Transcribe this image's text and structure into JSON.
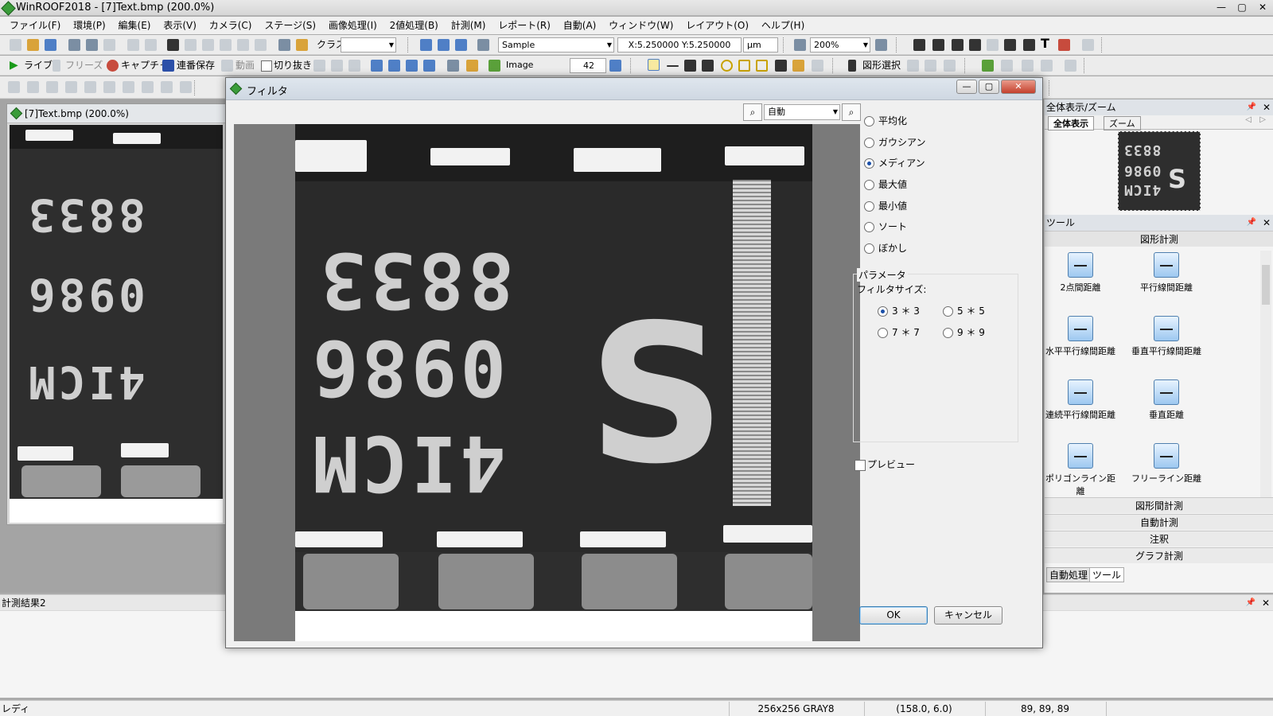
{
  "app": {
    "title": "WinROOF2018 - [7]Text.bmp (200.0%)"
  },
  "window_controls": {
    "minimize": "—",
    "restore": "▢",
    "close": "✕"
  },
  "menu": [
    "ファイル(F)",
    "環境(P)",
    "編集(E)",
    "表示(V)",
    "カメラ(C)",
    "ステージ(S)",
    "画像処理(I)",
    "2値処理(B)",
    "計測(M)",
    "レポート(R)",
    "自動(A)",
    "ウィンドウ(W)",
    "レイアウト(O)",
    "ヘルプ(H)"
  ],
  "toolbar1": {
    "class_label": "クラス",
    "class_value": "",
    "sample_value": "Sample",
    "coords": "X:5.250000  Y:5.250000",
    "unit": "μm",
    "zoom": "200%"
  },
  "toolbar2": {
    "live": "ライブ",
    "freeze": "フリーズ",
    "capture": "キャプチャ",
    "serial_save": "連番保存",
    "video": "動画",
    "crop": "切り抜き",
    "image_value": "Image",
    "spin_value": "42",
    "shape_select": "図形選択"
  },
  "child_window": {
    "title": "[7]Text.bmp (200.0%)"
  },
  "dialog": {
    "title": "フィルタ",
    "zoom_value": "自動",
    "filters": [
      "平均化",
      "ガウシアン",
      "メディアン",
      "最大値",
      "最小値",
      "ソート",
      "ぼかし"
    ],
    "selected_filter": "メディアン",
    "param_group": "パラメータ",
    "filter_size_label": "フィルタサイズ:",
    "sizes": [
      "3 ＊ 3",
      "5 ＊ 5",
      "7 ＊ 7",
      "9 ＊ 9"
    ],
    "selected_size": "3 ＊ 3",
    "preview_label": "プレビュー",
    "preview_checked": false,
    "ok": "OK",
    "cancel": "キャンセル"
  },
  "chip_marking": {
    "line1": "8833",
    "line2": "0986",
    "line3": "4ICM",
    "logo": "S"
  },
  "right_panel": {
    "overview": {
      "title": "全体表示/ズーム",
      "tab_all": "全体表示",
      "tab_zoom": "ズーム"
    },
    "tools": {
      "title": "ツール",
      "group": "図形計測",
      "items": [
        "2点間距離",
        "平行線間距離",
        "水平平行線間距離",
        "垂直平行線間距離",
        "連続平行線間距離",
        "垂直距離",
        "ポリゴンライン距離",
        "フリーライン距離"
      ],
      "sections": [
        "図形間計測",
        "自動計測",
        "注釈",
        "グラフ計測"
      ],
      "bottom_tabs": [
        "自動処理",
        "ツール"
      ]
    }
  },
  "results": {
    "title": "計測結果2"
  },
  "status": {
    "ready": "レディ",
    "image_info": "256x256 GRAY8",
    "position": "(158.0, 6.0)",
    "values": "89, 89, 89"
  }
}
